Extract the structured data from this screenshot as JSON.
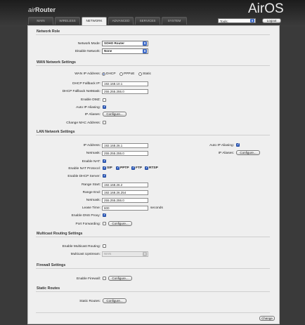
{
  "header": {
    "brand_prefix": "air",
    "brand_name": "Router",
    "logo": "AirOS",
    "tabs": [
      {
        "label": "MAIN",
        "active": false
      },
      {
        "label": "WIRELESS",
        "active": false
      },
      {
        "label": "NETWORK",
        "active": true
      },
      {
        "label": "ADVANCED",
        "active": false
      },
      {
        "label": "SERVICES",
        "active": false
      },
      {
        "label": "SYSTEM",
        "active": false
      }
    ],
    "tools_value": "Tools:",
    "logout_label": "Logout"
  },
  "network_role": {
    "title": "Network Role",
    "network_mode_label": "Network Mode:",
    "network_mode_value": "SOHO Router",
    "disable_network_label": "Disable Network:",
    "disable_network_value": "None"
  },
  "wan": {
    "title": "WAN Network Settings",
    "ip_address_label": "WAN IP Address:",
    "ip_options": [
      {
        "label": "DHCP",
        "selected": true
      },
      {
        "label": "PPPoE",
        "selected": false
      },
      {
        "label": "Static",
        "selected": false
      }
    ],
    "dhcp_fallback_ip_label": "DHCP Fallback IP:",
    "dhcp_fallback_ip_value": "192.168.10.1",
    "dhcp_fallback_netmask_label": "DHCP Fallback NetMask:",
    "dhcp_fallback_netmask_value": "255.255.255.0",
    "enable_dmz_label": "Enable DMZ:",
    "enable_dmz_checked": false,
    "auto_ip_aliasing_label": "Auto IP Aliasing:",
    "auto_ip_aliasing_checked": true,
    "ip_aliases_label": "IP Aliases:",
    "ip_aliases_button": "Configure...",
    "change_mac_label": "Change MAC Address:",
    "change_mac_checked": false
  },
  "lan": {
    "title": "LAN Network Settings",
    "ip_address_label": "IP Address:",
    "ip_address_value": "192.168.26.1",
    "netmask_label": "Netmask:",
    "netmask_value": "255.255.255.0",
    "auto_ip_aliasing_label": "Auto IP Aliasing:",
    "auto_ip_aliasing_checked": true,
    "ip_aliases_label": "IP Aliases:",
    "ip_aliases_button": "Configure...",
    "enable_nat_label": "Enable NAT:",
    "enable_nat_checked": true,
    "enable_nat_protocol_label": "Enable NAT Protocol:",
    "nat_protocols": [
      {
        "label": "SIP",
        "checked": true
      },
      {
        "label": "PPTP",
        "checked": true
      },
      {
        "label": "FTP",
        "checked": true
      },
      {
        "label": "RTSP",
        "checked": true
      }
    ],
    "enable_dhcp_server_label": "Enable DHCP Server:",
    "enable_dhcp_server_checked": true,
    "range_start_label": "Range Start:",
    "range_start_value": "192.168.26.2",
    "range_end_label": "Range End:",
    "range_end_value": "192.168.26.254",
    "dhcp_netmask_label": "Netmask:",
    "dhcp_netmask_value": "255.255.255.0",
    "lease_time_label": "Lease Time:",
    "lease_time_value": "600",
    "lease_time_unit": "seconds",
    "enable_dns_proxy_label": "Enable DNS Proxy:",
    "enable_dns_proxy_checked": true,
    "port_forwarding_label": "Port Forwarding:",
    "port_forwarding_checked": false,
    "port_forwarding_button": "Configure..."
  },
  "multicast": {
    "title": "Multicast Routing Settings",
    "enable_label": "Enable Multicast Routing:",
    "enable_checked": false,
    "upstream_label": "Multicast Upstream:",
    "upstream_value": "WAN"
  },
  "firewall": {
    "title": "Firewall Settings",
    "enable_label": "Enable Firewall:",
    "enable_checked": false,
    "button": "Configure..."
  },
  "static_routes": {
    "title": "Static Routes",
    "label": "Static Routes:",
    "button": "Configure..."
  },
  "footer": {
    "change_button": "Change"
  },
  "colors": {
    "accent": "#3a68c8",
    "header_bg": "#1c1c1c",
    "panel_bg": "#efefef"
  }
}
